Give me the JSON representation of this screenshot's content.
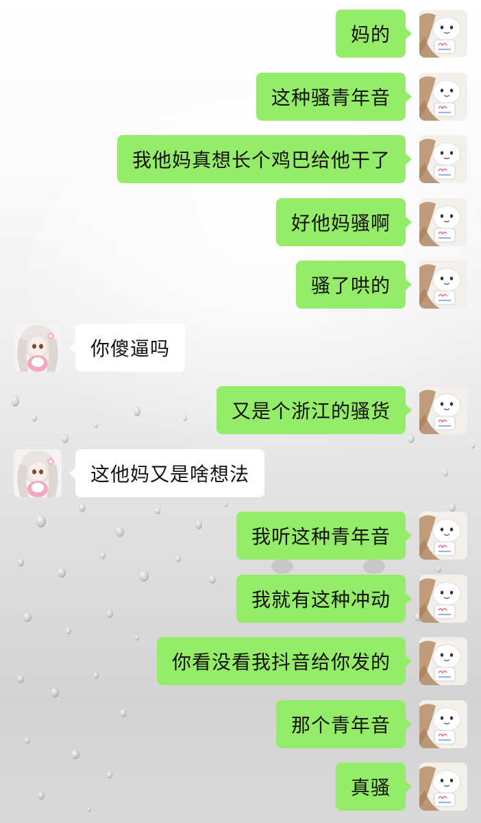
{
  "colors": {
    "self_bubble": "#95ec69",
    "other_bubble": "#ffffff",
    "text": "#111111"
  },
  "messages": [
    {
      "sender": "self",
      "text": "妈的"
    },
    {
      "sender": "self",
      "text": "这种骚青年音"
    },
    {
      "sender": "self",
      "text": "我他妈真想长个鸡巴给他干了"
    },
    {
      "sender": "self",
      "text": "好他妈骚啊"
    },
    {
      "sender": "self",
      "text": "骚了哄的"
    },
    {
      "sender": "other",
      "text": "你傻逼吗"
    },
    {
      "sender": "self",
      "text": "又是个浙江的骚货"
    },
    {
      "sender": "other",
      "text": "这他妈又是啥想法"
    },
    {
      "sender": "self",
      "text": "我听这种青年音"
    },
    {
      "sender": "self",
      "text": "我就有这种冲动"
    },
    {
      "sender": "self",
      "text": "你看没看我抖音给你发的"
    },
    {
      "sender": "self",
      "text": "那个青年音"
    },
    {
      "sender": "self",
      "text": "真骚"
    }
  ]
}
